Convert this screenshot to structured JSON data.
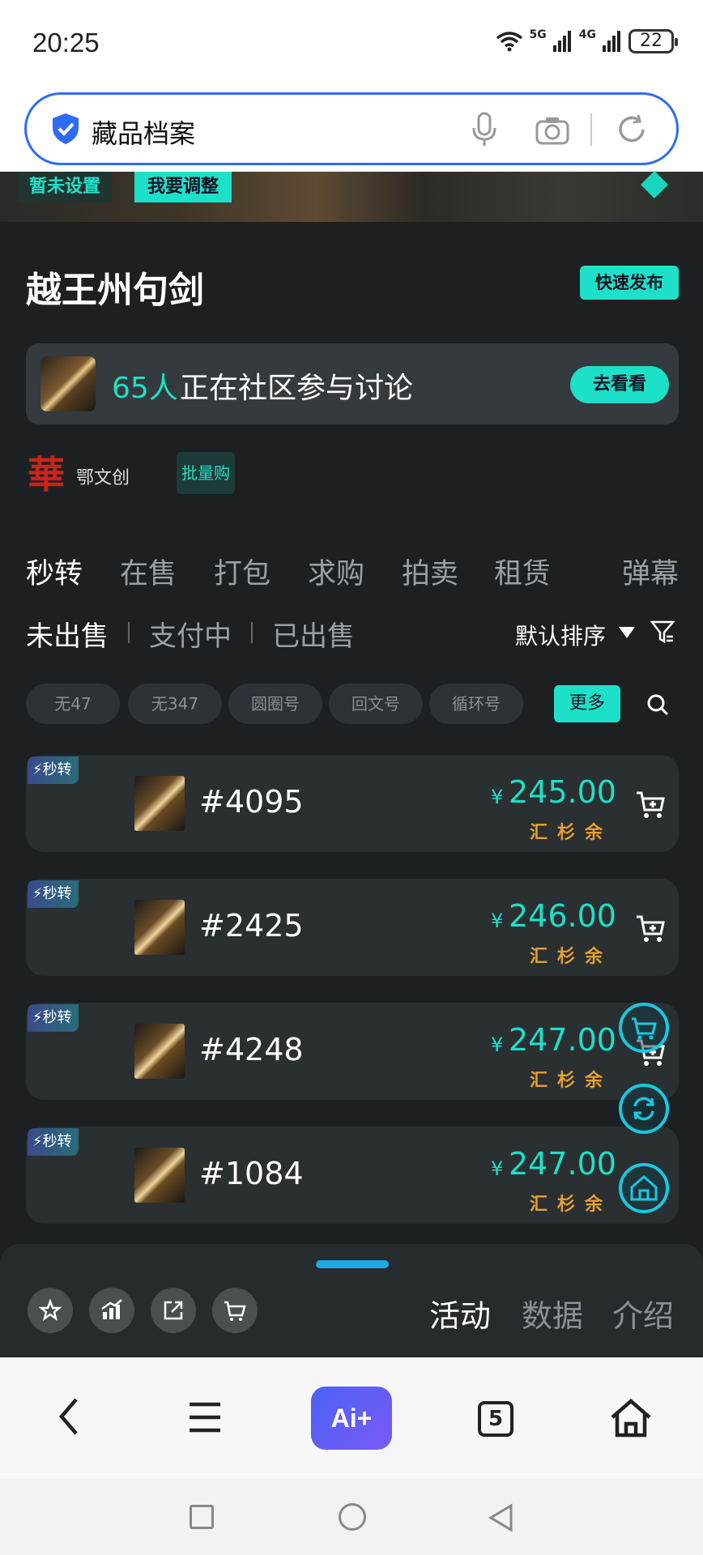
{
  "status_bar": {
    "time": "20:25",
    "net1": "5G",
    "net2": "4G",
    "battery": "22"
  },
  "search": {
    "text": "藏品档案"
  },
  "banner": {
    "tag_unset": "暂未设置",
    "tag_adjust": "我要调整"
  },
  "header": {
    "title": "越王州句剑",
    "publish_label": "快速发布"
  },
  "community": {
    "count": "65人",
    "text": "正在社区参与讨论",
    "button": "去看看"
  },
  "brand": {
    "logo_char": "華",
    "name": "鄂文创",
    "bulk_label": "批量购"
  },
  "main_tabs": [
    "秒转",
    "在售",
    "打包",
    "求购",
    "拍卖",
    "租赁",
    "弹幕"
  ],
  "sub_tabs": [
    "未出售",
    "支付中",
    "已出售"
  ],
  "sort": {
    "label": "默认排序"
  },
  "chips": [
    "无47",
    "无347",
    "圆圈号",
    "回文号",
    "循环号"
  ],
  "more_label": "更多",
  "listings": [
    {
      "badge": "秒转",
      "number": "#4095",
      "currency": "¥",
      "price": "245.00",
      "tag": "汇杉余"
    },
    {
      "badge": "秒转",
      "number": "#2425",
      "currency": "¥",
      "price": "246.00",
      "tag": "汇杉余"
    },
    {
      "badge": "秒转",
      "number": "#4248",
      "currency": "¥",
      "price": "247.00",
      "tag": "汇杉余"
    },
    {
      "badge": "秒转",
      "number": "#1084",
      "currency": "¥",
      "price": "247.00",
      "tag": "汇杉余"
    }
  ],
  "action_tabs": [
    "活动",
    "数据",
    "介绍"
  ],
  "browser": {
    "ai_label": "Ai+",
    "tab_count": "5"
  },
  "colors": {
    "accent": "#1de0c8",
    "background": "#1c2023",
    "price_tag": "#e8a030",
    "search_border": "#2f6cf6"
  },
  "icons": [
    "shield-icon",
    "mic-icon",
    "camera-icon",
    "refresh-icon",
    "filter-icon",
    "search-icon",
    "cart-icon",
    "star-icon",
    "chart-icon",
    "share-icon",
    "back-icon",
    "menu-icon",
    "home-icon"
  ]
}
